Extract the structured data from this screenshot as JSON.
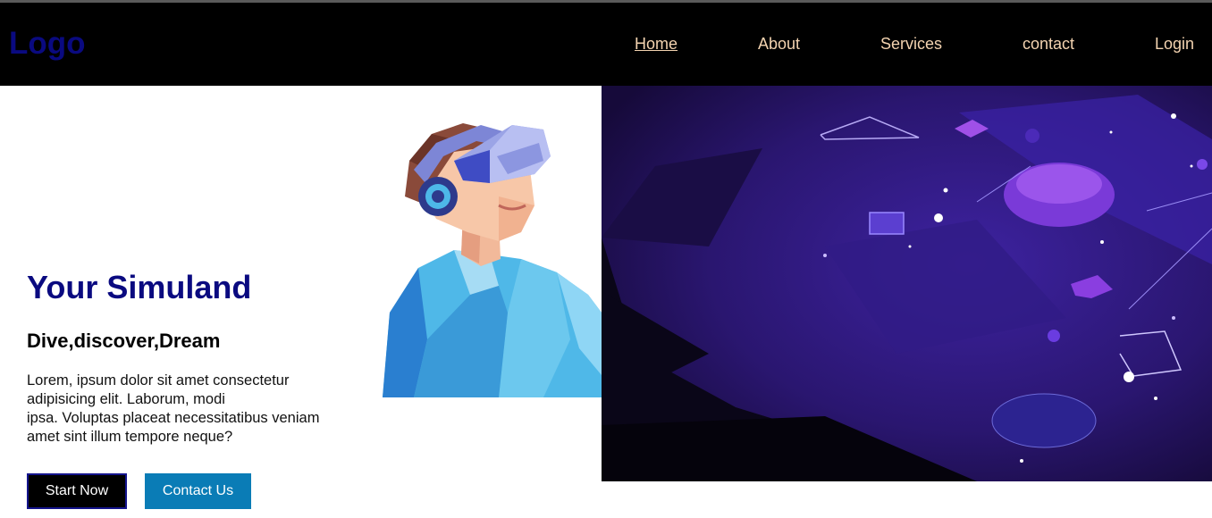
{
  "nav": {
    "logo": "Logo",
    "links": [
      {
        "label": "Home",
        "active": true
      },
      {
        "label": "About"
      },
      {
        "label": "Services"
      },
      {
        "label": "contact"
      },
      {
        "label": "Login"
      }
    ]
  },
  "hero": {
    "title": "Your Simuland",
    "subtitle": "Dive,discover,Dream",
    "body_lines": [
      "Lorem, ipsum dolor sit amet consectetur",
      "adipisicing elit. Laborum, modi",
      "ipsa. Voluptas placeat necessitatibus veniam",
      "amet sint illum tempore neque?"
    ],
    "buttons": {
      "start": "Start Now",
      "contact": "Contact Us"
    }
  },
  "colors": {
    "nav_bg": "#000000",
    "logo": "#0a0a80",
    "nav_link": "#f3d3b0",
    "title": "#0a0a80",
    "contact_button": "#0a7cb6",
    "space_bg": "#2a1466"
  },
  "images": {
    "vr_illustration": "person-with-vr-headset-illustration",
    "space_artwork": "purple-cosmic-geometric-artwork"
  }
}
